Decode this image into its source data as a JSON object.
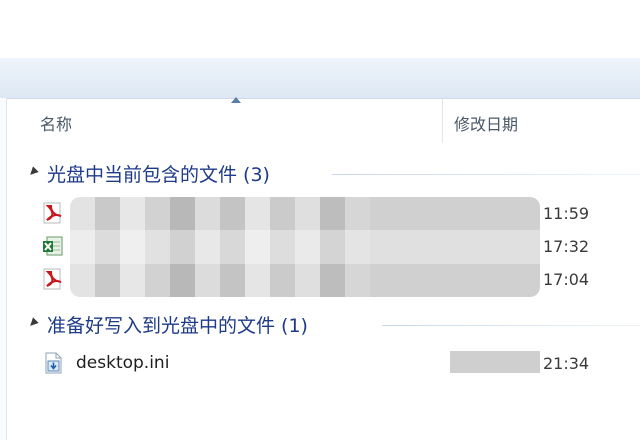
{
  "columns": {
    "name": "名称",
    "date_modified": "修改日期"
  },
  "groups": [
    {
      "title": "光盘中当前包含的文件 (3)"
    },
    {
      "title": "准备好写入到光盘中的文件 (1)"
    }
  ],
  "current_files": [
    {
      "icon": "pdf-icon",
      "time": "11:59"
    },
    {
      "icon": "excel-icon",
      "time": "17:32"
    },
    {
      "icon": "pdf-icon",
      "time": "17:04"
    }
  ],
  "pending_files": [
    {
      "icon": "ini-file-icon",
      "name": "desktop.ini",
      "time": "21:34"
    }
  ],
  "colors": {
    "group_title": "#1e3b8a",
    "toolbar": "#dde8f4"
  }
}
